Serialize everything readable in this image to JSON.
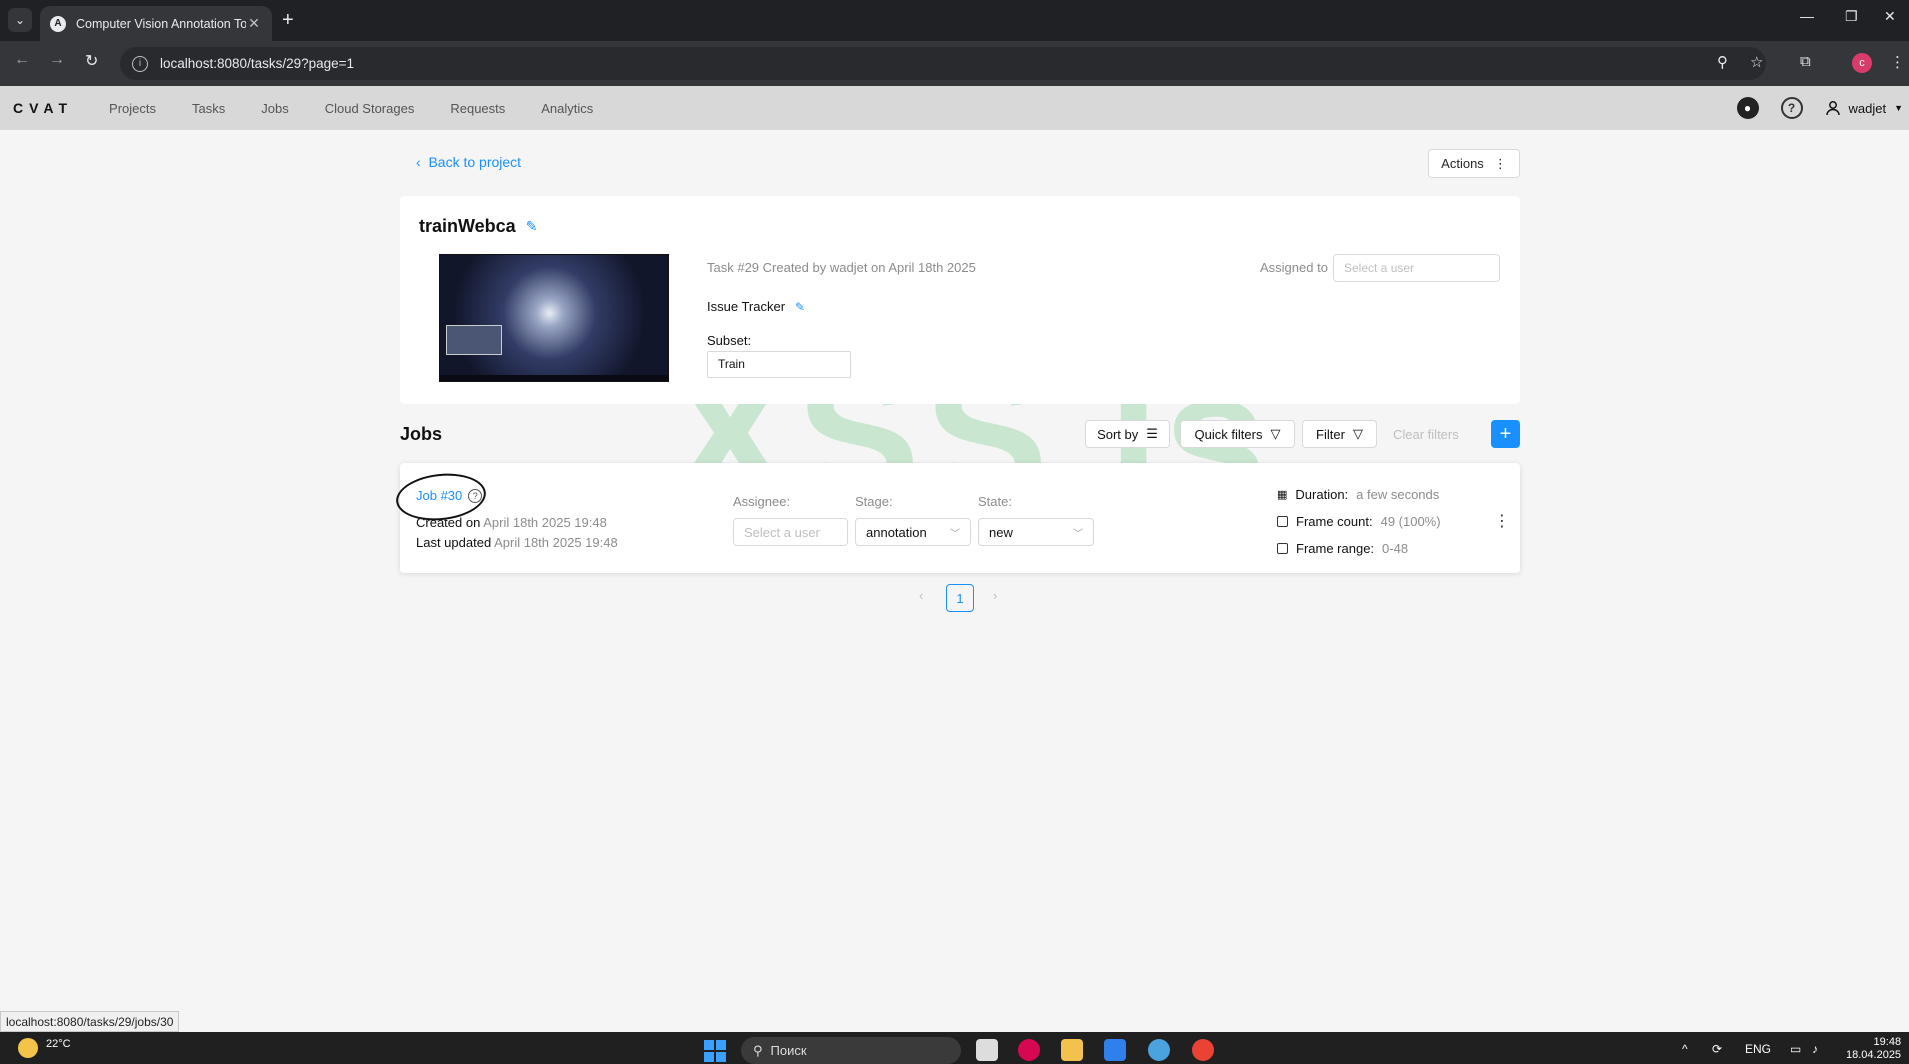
{
  "browser": {
    "tab_title": "Computer Vision Annotation To",
    "url": "localhost:8080/tasks/29?page=1",
    "profile_initial": "c"
  },
  "header": {
    "logo": "CVAT",
    "nav": [
      "Projects",
      "Tasks",
      "Jobs",
      "Cloud Storages",
      "Requests",
      "Analytics"
    ],
    "username": "wadjet"
  },
  "page": {
    "back_label": "Back to project",
    "actions_label": "Actions"
  },
  "task": {
    "name": "trainWebca",
    "meta": "Task #29 Created by wadjet on April 18th 2025",
    "issue_tracker": "Issue Tracker",
    "subset_label": "Subset:",
    "subset_value": "Train",
    "assigned_label": "Assigned to",
    "assigned_placeholder": "Select a user"
  },
  "jobs": {
    "title": "Jobs",
    "sort_by": "Sort by",
    "quick_filters": "Quick filters",
    "filter": "Filter",
    "clear_filters": "Clear filters",
    "items": [
      {
        "name": "Job #30",
        "created_label": "Created on",
        "created_value": "April 18th 2025 19:48",
        "updated_label": "Last updated",
        "updated_value": "April 18th 2025 19:48",
        "assignee_label": "Assignee:",
        "assignee_placeholder": "Select a user",
        "stage_label": "Stage:",
        "stage_value": "annotation",
        "state_label": "State:",
        "state_value": "new",
        "duration_label": "Duration:",
        "duration_value": "a few seconds",
        "frame_count_label": "Frame count:",
        "frame_count_value": "49 (100%)",
        "frame_range_label": "Frame range:",
        "frame_range_value": "0-48"
      }
    ]
  },
  "pagination": {
    "current": "1"
  },
  "watermark": "XSS.is",
  "status_url": "localhost:8080/tasks/29/jobs/30",
  "taskbar": {
    "temperature": "22°C",
    "search_placeholder": "Поиск",
    "lang": "ENG",
    "time": "19:48",
    "date": "18.04.2025"
  }
}
